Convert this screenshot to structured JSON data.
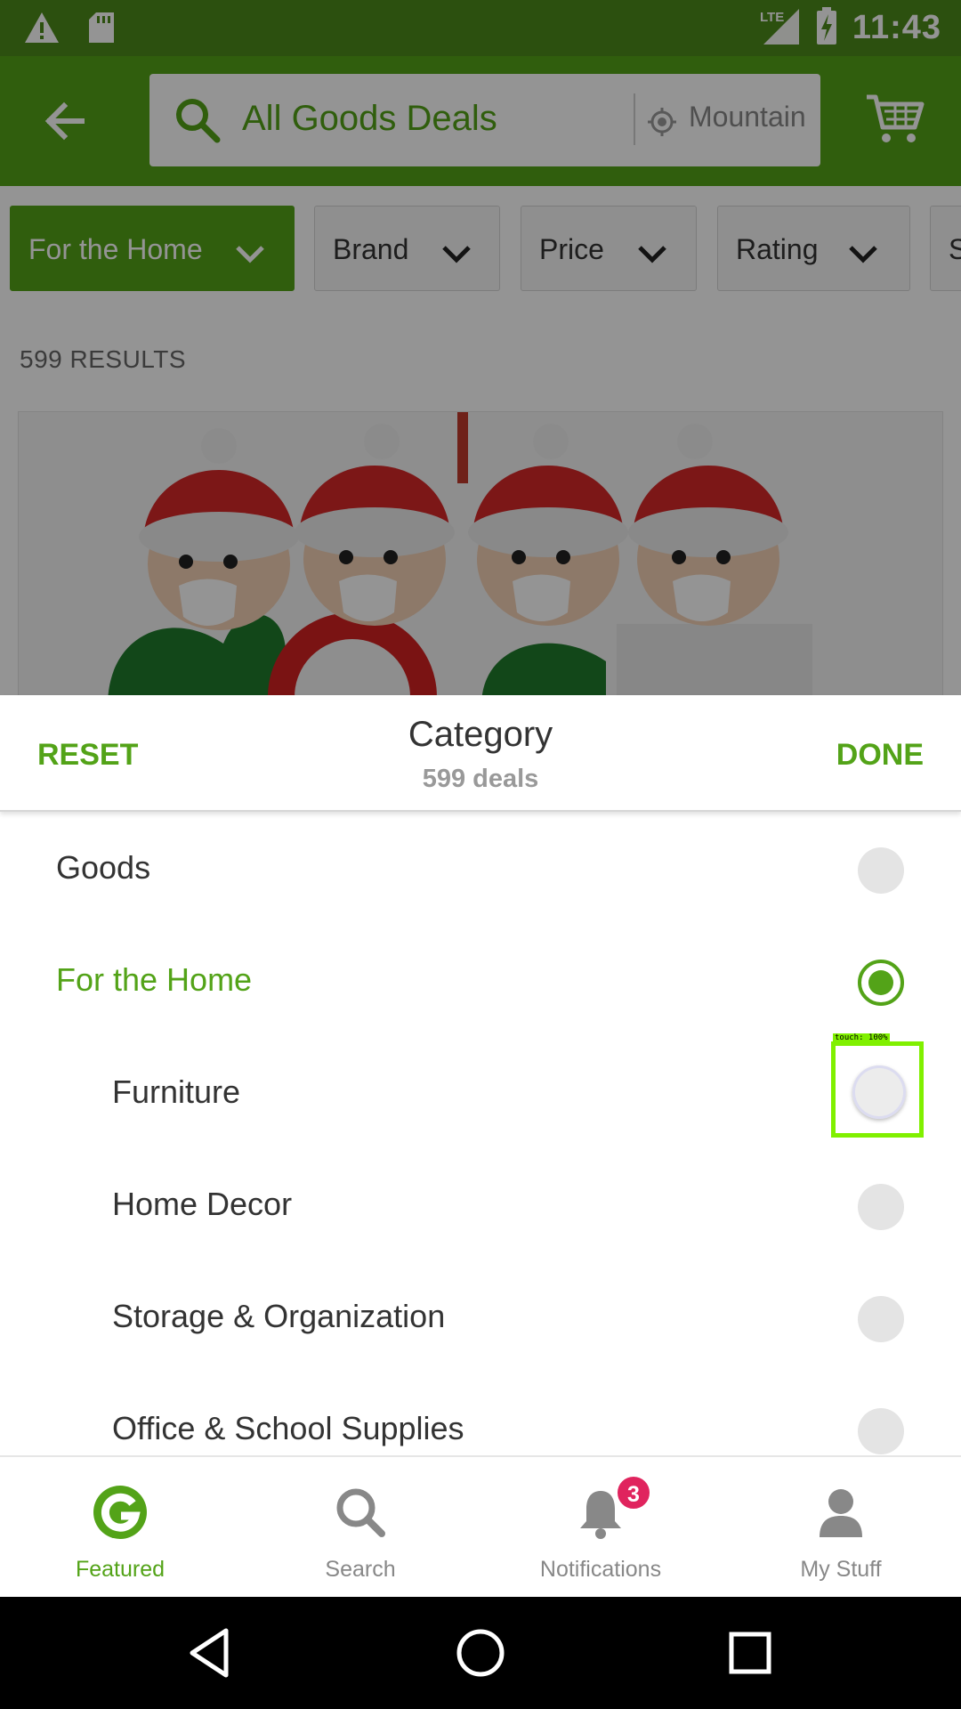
{
  "status_bar": {
    "time": "11:43",
    "network": "LTE",
    "icons": [
      "warning-icon",
      "sd-card-icon",
      "signal-icon",
      "battery-charging-icon"
    ]
  },
  "header": {
    "search_text": "All Goods Deals",
    "location_text": "Mountain View",
    "icons": [
      "back-arrow-icon",
      "search-icon",
      "location-icon",
      "cart-icon"
    ]
  },
  "filters": [
    {
      "label": "For the Home",
      "active": true
    },
    {
      "label": "Brand",
      "active": false
    },
    {
      "label": "Price",
      "active": false
    },
    {
      "label": "Rating",
      "active": false
    },
    {
      "label": "S",
      "active": false
    }
  ],
  "results": {
    "count_label": "599 RESULTS"
  },
  "sheet": {
    "reset_label": "RESET",
    "done_label": "DONE",
    "title": "Category",
    "subtitle": "599 deals",
    "items": [
      {
        "label": "Goods",
        "selected": false
      },
      {
        "label": "For the Home",
        "selected": true
      },
      {
        "label": "Furniture",
        "selected": false
      },
      {
        "label": "Home Decor",
        "selected": false
      },
      {
        "label": "Storage & Organization",
        "selected": false
      },
      {
        "label": "Office & School Supplies",
        "selected": false
      }
    ]
  },
  "touch_indicator": {
    "label": "touch: 100%"
  },
  "bottom_nav": {
    "items": [
      {
        "label": "Featured",
        "icon": "groupon-g-icon",
        "active": true
      },
      {
        "label": "Search",
        "icon": "search-icon",
        "active": false
      },
      {
        "label": "Notifications",
        "icon": "bell-icon",
        "active": false,
        "badge": "3"
      },
      {
        "label": "My Stuff",
        "icon": "person-icon",
        "active": false
      }
    ]
  },
  "colors": {
    "brand_green": "#53a318",
    "status_green": "#4c8a1b",
    "badge_red": "#e0245e"
  }
}
